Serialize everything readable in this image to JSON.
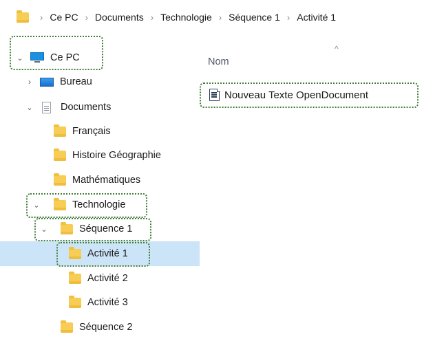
{
  "breadcrumb": {
    "items": [
      "Ce PC",
      "Documents",
      "Technologie",
      "Séquence 1",
      "Activité 1"
    ],
    "separator": "›"
  },
  "tree": {
    "expanded_chevron": "⌄",
    "collapsed_chevron": "›",
    "items": [
      {
        "label": "Ce PC",
        "icon": "computer-icon",
        "state": "expanded"
      },
      {
        "label": "Bureau",
        "icon": "desktop-icon",
        "state": "collapsed"
      },
      {
        "label": "Documents",
        "icon": "documents-icon",
        "state": "expanded"
      },
      {
        "label": "Français",
        "icon": "folder-icon",
        "state": "none"
      },
      {
        "label": "Histoire Géographie",
        "icon": "folder-icon",
        "state": "none"
      },
      {
        "label": "Mathématiques",
        "icon": "folder-icon",
        "state": "none"
      },
      {
        "label": "Technologie",
        "icon": "folder-icon",
        "state": "expanded"
      },
      {
        "label": "Séquence 1",
        "icon": "folder-icon",
        "state": "expanded"
      },
      {
        "label": "Activité 1",
        "icon": "folder-icon",
        "state": "none",
        "selected": true
      },
      {
        "label": "Activité 2",
        "icon": "folder-icon",
        "state": "none"
      },
      {
        "label": "Activité 3",
        "icon": "folder-icon",
        "state": "none"
      },
      {
        "label": "Séquence 2",
        "icon": "folder-icon",
        "state": "none"
      }
    ]
  },
  "content": {
    "column_header": "Nom",
    "sort_indicator": "^",
    "files": [
      {
        "name": "Nouveau Texte OpenDocument",
        "icon": "odt-document-icon"
      }
    ]
  },
  "colors": {
    "selection": "#cce4f7",
    "highlight_border": "#3e7d34",
    "folder": "#f7cd55"
  }
}
